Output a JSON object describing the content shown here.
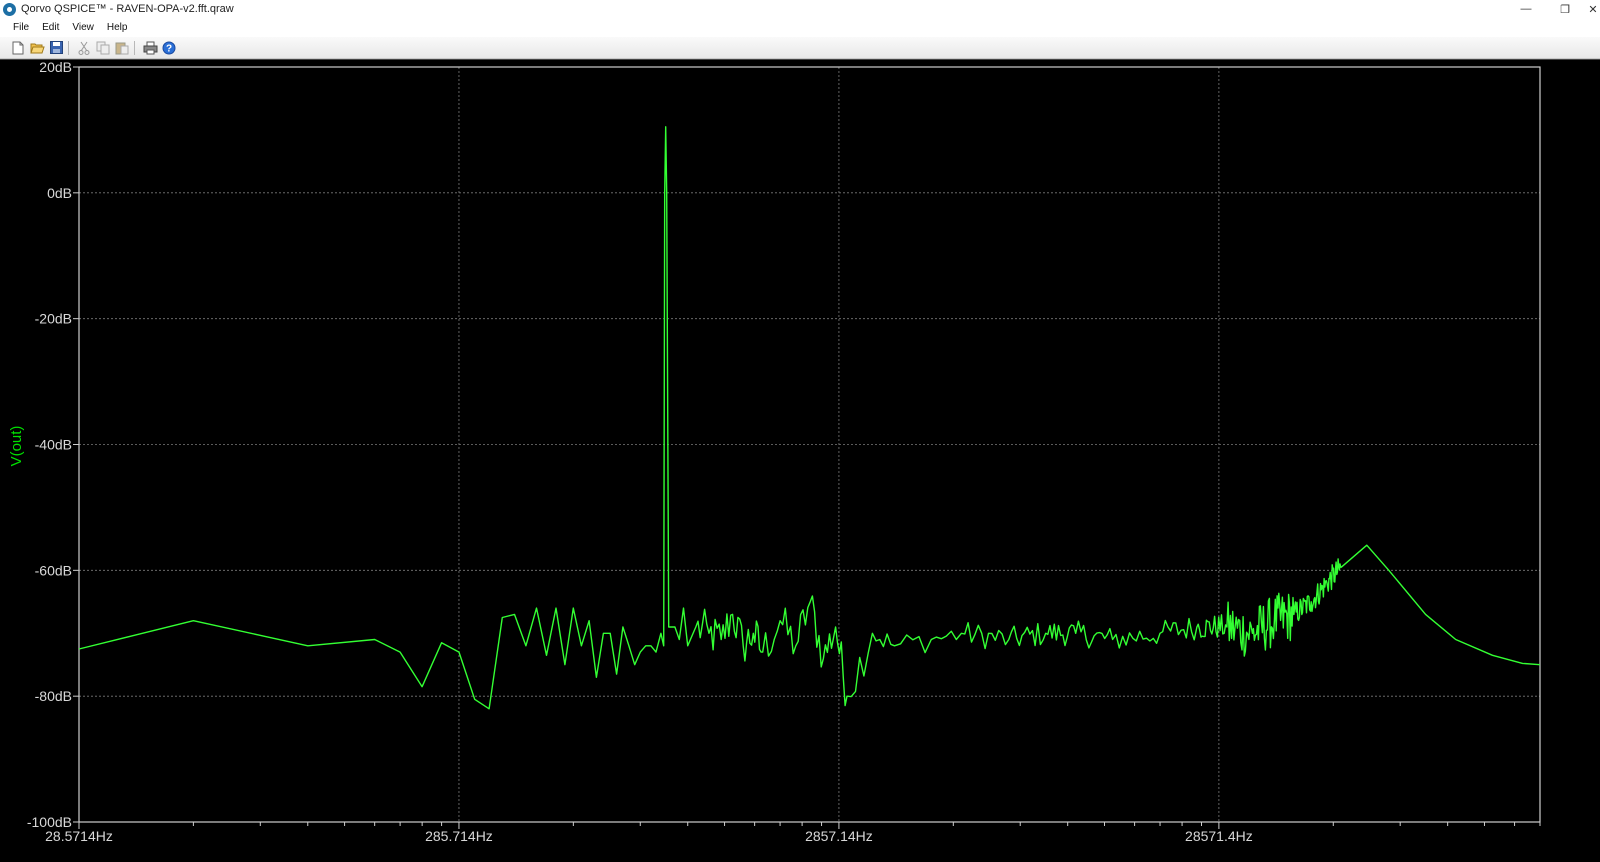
{
  "window": {
    "title": "Qorvo QSPICE™ - RAVEN-OPA-v2.fft.qraw",
    "min_glyph": "—",
    "restore_glyph": "❐",
    "close_glyph": "✕"
  },
  "menu": {
    "items": [
      "File",
      "Edit",
      "View",
      "Help"
    ]
  },
  "toolbar": {
    "buttons": [
      "new-file-icon",
      "open-folder-icon",
      "save-icon",
      "cut-icon",
      "copy-icon",
      "paste-icon",
      "print-icon",
      "help-icon"
    ]
  },
  "colors": {
    "trace": "#33ff33",
    "label": "#00e000",
    "grid": "#7a7a7a",
    "axis_text": "#d8d8d8",
    "background": "#000000"
  },
  "chart_data": {
    "type": "line",
    "title": "",
    "ylabel": "V(out)",
    "xlabel": "",
    "x_scale": "log",
    "xlim": [
      28.5714,
      200000
    ],
    "ylim": [
      -100,
      20
    ],
    "x_ticks": [
      28.5714,
      285.714,
      2857.14,
      28571.4
    ],
    "x_tick_labels": [
      "28.5714Hz",
      "285.714Hz",
      "2857.14Hz",
      "28571.4Hz"
    ],
    "y_ticks": [
      20,
      0,
      -20,
      -40,
      -60,
      -80,
      -100
    ],
    "y_tick_labels": [
      "20dB",
      "0dB",
      "-20dB",
      "-40dB",
      "-60dB",
      "-80dB",
      "-100dB"
    ],
    "series": [
      {
        "x": [
          28.57,
          57.14,
          114.29,
          171.43,
          200,
          228.57,
          257.14,
          285.71,
          314.29,
          342.86,
          371.43,
          400,
          428.57,
          457.14,
          485.71,
          514.29,
          542.86,
          571.43,
          600,
          628.57,
          657.14,
          685.71,
          714.29,
          742.86,
          771.43,
          800,
          828.57,
          857.14,
          885.71,
          914.29,
          942.86,
          971.43,
          1000,
          1028.57,
          1057.14,
          1085.71,
          1114.29,
          1142.86,
          1200,
          1300,
          1400,
          1500,
          1600,
          1700,
          1800,
          2000,
          2200,
          2400,
          2600,
          2800,
          3000,
          3500,
          4000,
          5000,
          6000,
          8000,
          10000,
          12000,
          15000,
          20000,
          25000,
          30000,
          35000,
          40000,
          45000,
          50000,
          55000,
          60000,
          70000,
          80000,
          100000,
          120000,
          150000,
          180000,
          200000
        ],
        "values": [
          -72.5,
          -68,
          -72,
          -71,
          -73,
          -78.5,
          -71.5,
          -73,
          -80.5,
          -82,
          -67.5,
          -67,
          -72,
          -66,
          -73.5,
          -66,
          -75,
          -66,
          -72,
          -68,
          -77,
          -70,
          -70,
          -76.5,
          -69,
          -72,
          -75,
          -73,
          -72,
          -72,
          -73,
          -70,
          10.5,
          -69,
          -69,
          -71,
          -66,
          -72,
          -69,
          -70,
          -71,
          -67,
          -72,
          -70,
          -73,
          -68,
          -72,
          -65,
          -74,
          -69,
          -80,
          -70,
          -72,
          -71,
          -70,
          -71,
          -70,
          -70,
          -71,
          -70,
          -69,
          -69,
          -70,
          -68,
          -67,
          -65,
          -62,
          -59.5,
          -56,
          -60,
          -67,
          -71,
          -73.5,
          -74.8,
          -75
        ]
      }
    ]
  }
}
